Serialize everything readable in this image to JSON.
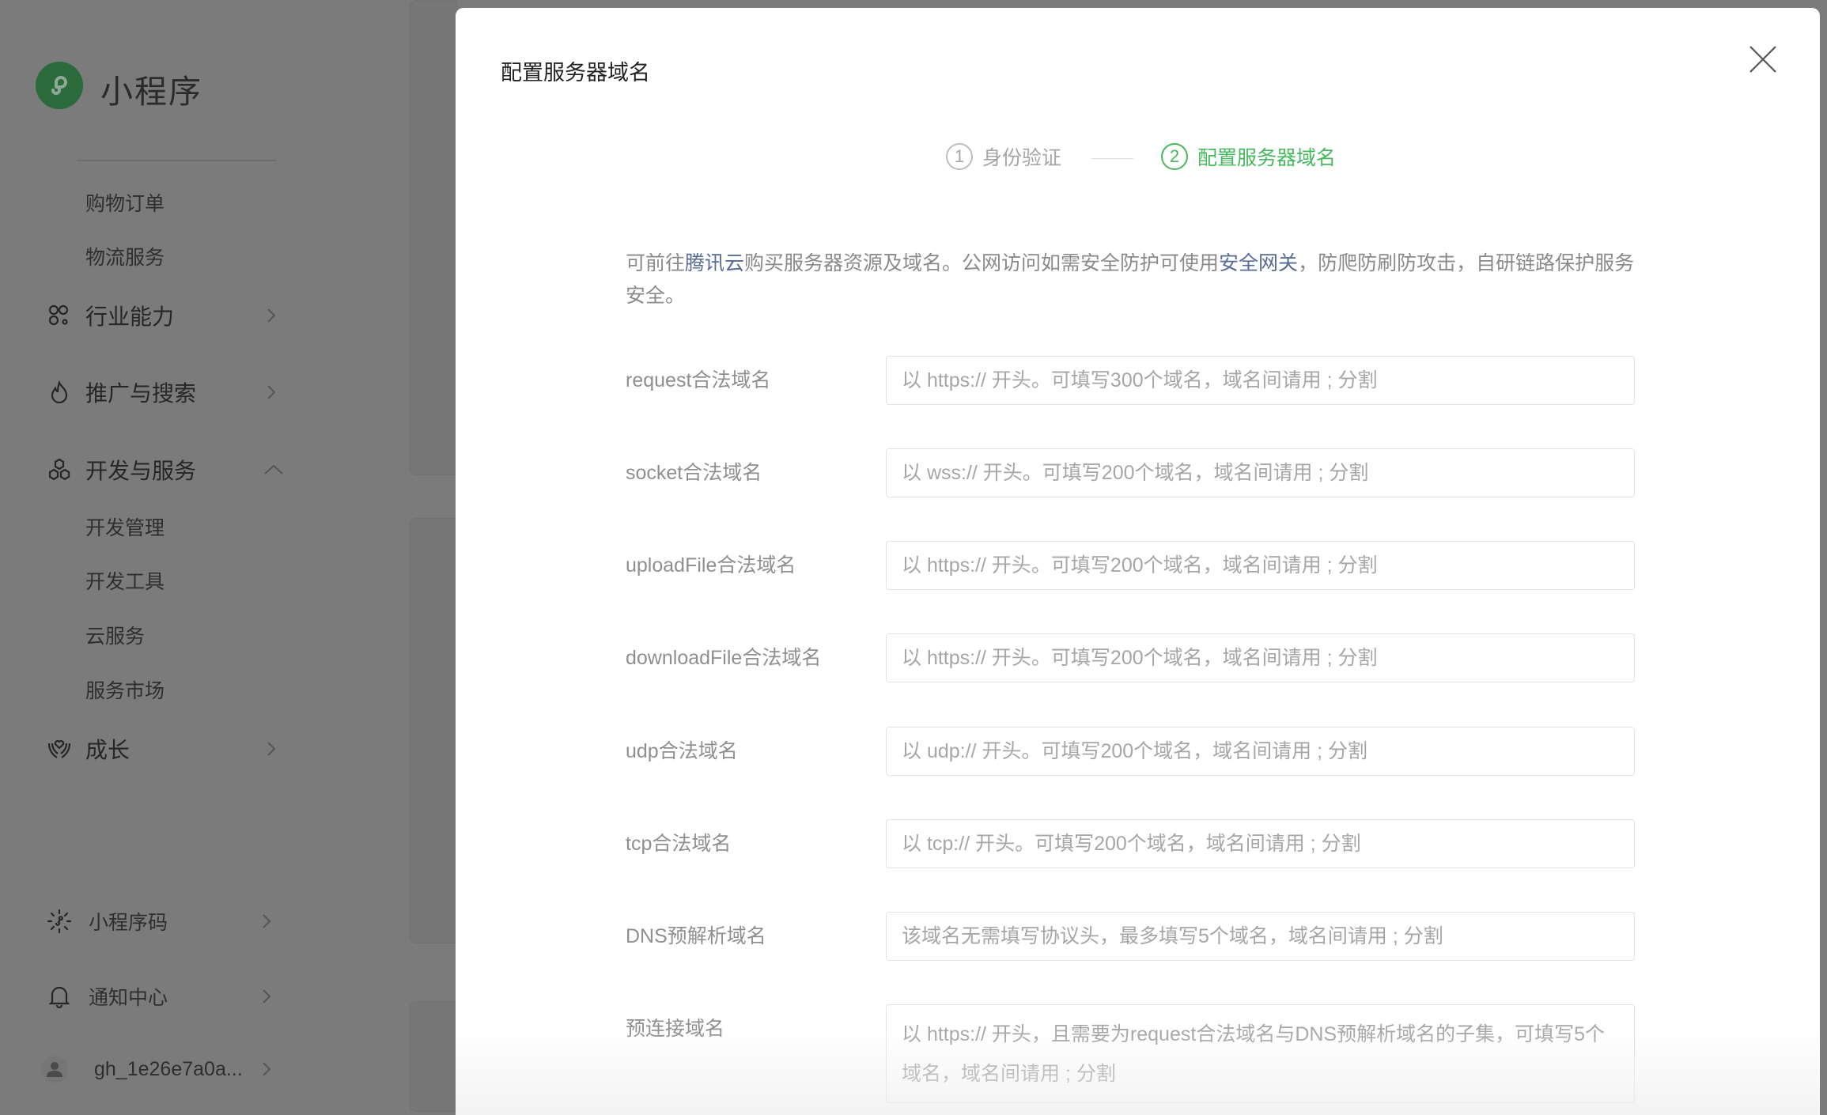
{
  "sidebar": {
    "app_title": "小程序",
    "items": [
      {
        "label": "购物订单"
      },
      {
        "label": "物流服务"
      },
      {
        "label": "行业能力"
      },
      {
        "label": "推广与搜索"
      },
      {
        "label": "开发与服务"
      },
      {
        "label": "开发管理"
      },
      {
        "label": "开发工具"
      },
      {
        "label": "云服务"
      },
      {
        "label": "服务市场"
      },
      {
        "label": "成长"
      }
    ],
    "bottom": [
      {
        "label": "小程序码"
      },
      {
        "label": "通知中心"
      },
      {
        "label": "gh_1e26e7a0a..."
      }
    ]
  },
  "modal": {
    "title": "配置服务器域名",
    "steps": [
      {
        "num": "1",
        "label": "身份验证"
      },
      {
        "num": "2",
        "label": "配置服务器域名"
      }
    ],
    "desc": {
      "p1": "可前往",
      "link1": "腾讯云",
      "p2": "购买服务器资源及域名。公网访问如需安全防护可使用",
      "link2": "安全网关",
      "p3": "，防爬防刷防攻击，自研链路保护服务安全。"
    },
    "fields": [
      {
        "label": "request合法域名",
        "placeholder": "以 https:// 开头。可填写300个域名，域名间请用 ; 分割"
      },
      {
        "label": "socket合法域名",
        "placeholder": "以 wss:// 开头。可填写200个域名，域名间请用 ; 分割"
      },
      {
        "label": "uploadFile合法域名",
        "placeholder": "以 https:// 开头。可填写200个域名，域名间请用 ; 分割"
      },
      {
        "label": "downloadFile合法域名",
        "placeholder": "以 https:// 开头。可填写200个域名，域名间请用 ; 分割"
      },
      {
        "label": "udp合法域名",
        "placeholder": "以 udp:// 开头。可填写200个域名，域名间请用 ; 分割"
      },
      {
        "label": "tcp合法域名",
        "placeholder": "以 tcp:// 开头。可填写200个域名，域名间请用 ; 分割"
      },
      {
        "label": "DNS预解析域名",
        "placeholder": "该域名无需填写协议头，最多填写5个域名，域名间请用 ; 分割"
      },
      {
        "label": "预连接域名",
        "placeholder": "以 https:// 开头，且需要为request合法域名与DNS预解析域名的子集，可填写5个域名，域名间请用 ; 分割"
      }
    ]
  },
  "colors": {
    "accent": "#47b85e",
    "link": "#576b95",
    "overlay": "#7b7b7b"
  }
}
